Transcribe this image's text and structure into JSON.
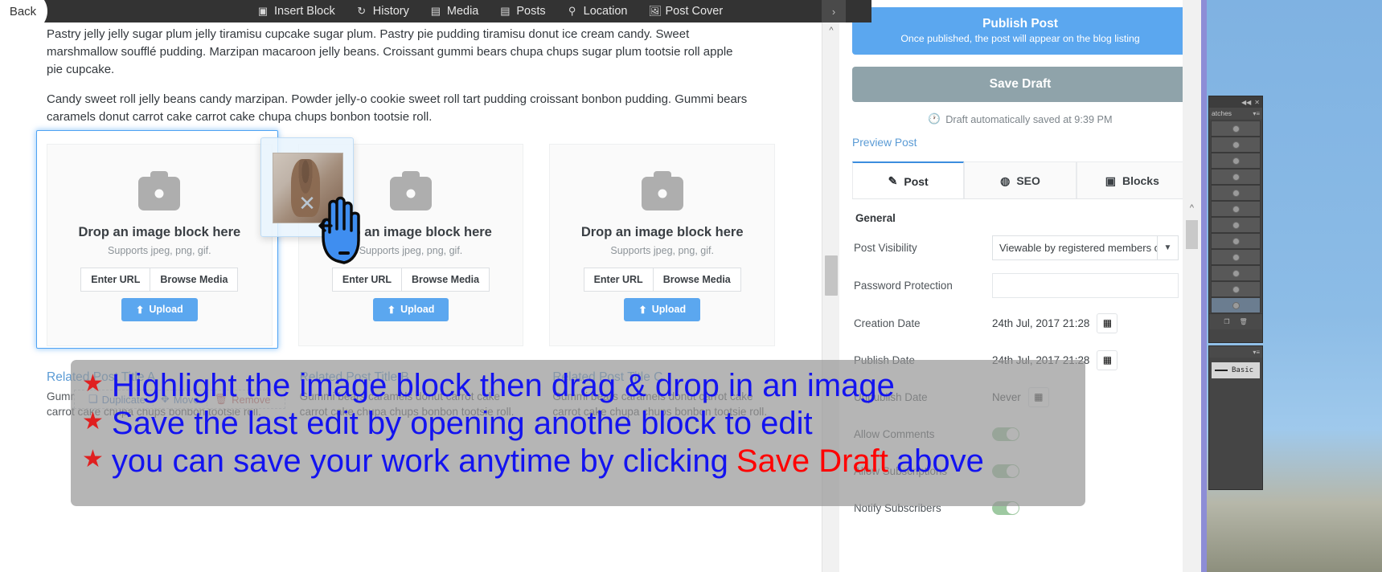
{
  "topbar": {
    "back_label": "Back",
    "menu": [
      {
        "label": "Insert Block",
        "icon": "cube-icon"
      },
      {
        "label": "History",
        "icon": "history-icon"
      },
      {
        "label": "Media",
        "icon": "camera-icon"
      },
      {
        "label": "Posts",
        "icon": "document-icon"
      },
      {
        "label": "Location",
        "icon": "map-pin-icon"
      },
      {
        "label": "Post Cover",
        "icon": "image-icon"
      }
    ],
    "overflow_chevron": "›"
  },
  "editor": {
    "paragraphs": [
      "Pastry jelly jelly sugar plum jelly tiramisu cupcake sugar plum. Pastry pie pudding tiramisu donut ice cream candy. Sweet marshmallow soufflé pudding. Marzipan macaroon jelly beans. Croissant gummi bears chupa chups sugar plum tootsie roll apple pie cupcake.",
      "Candy sweet roll jelly beans candy marzipan. Powder jelly-o cookie sweet roll tart pudding croissant bonbon pudding. Gummi bears caramels donut carrot cake carrot cake chupa chups bonbon tootsie roll."
    ],
    "image_blocks": [
      {
        "title": "Drop an image block here",
        "subtitle": "Supports jpeg, png, gif.",
        "enter_url": "Enter URL",
        "browse": "Browse Media",
        "upload": "Upload"
      },
      {
        "title": "Drop an image block here",
        "subtitle": "Supports jpeg, png, gif.",
        "enter_url": "Enter URL",
        "browse": "Browse Media",
        "upload": "Upload"
      },
      {
        "title": "Drop an image block here",
        "subtitle": "Supports jpeg, png, gif.",
        "enter_url": "Enter URL",
        "browse": "Browse Media",
        "upload": "Upload"
      }
    ],
    "block_toolbar": {
      "duplicate": "Duplicate",
      "move": "Move",
      "remove": "Remove"
    },
    "related_posts": [
      {
        "title": "Related Post Title A",
        "body": "Gummi bears caramels donut carrot cake carrot cake chupa chups bonbon tootsie roll."
      },
      {
        "title": "Related Post Title B",
        "body": "Gummi bears caramels donut carrot cake carrot cake chupa chups bonbon tootsie roll."
      },
      {
        "title": "Related Post Title C",
        "body": "Gummi bears caramels donut carrot cake carrot cake chupa chups bonbon tootsie roll."
      }
    ]
  },
  "sidebar": {
    "publish": {
      "title": "Publish Post",
      "subtitle": "Once published, the post will appear on the blog listing"
    },
    "save_draft": "Save Draft",
    "autosave": "Draft automatically saved at 9:39 PM",
    "autosave_icon": "clock-icon",
    "preview_link": "Preview Post",
    "tabs": [
      {
        "label": "Post",
        "icon": "pencil-icon",
        "active": true
      },
      {
        "label": "SEO",
        "icon": "globe-icon",
        "active": false
      },
      {
        "label": "Blocks",
        "icon": "cube-icon",
        "active": false
      }
    ],
    "general": {
      "heading": "General",
      "post_visibility_label": "Post Visibility",
      "post_visibility_value": "Viewable by registered members o",
      "password_label": "Password Protection",
      "password_value": "",
      "creation_date_label": "Creation Date",
      "creation_date_value": "24th Jul, 2017 21:28",
      "publish_date_label": "Publish Date",
      "publish_date_value": "24th Jul, 2017 21:28",
      "unpublish_date_label": "Unpublish Date",
      "unpublish_date_value": "Never",
      "allow_comments_label": "Allow Comments",
      "allow_subscriptions_label": "Allow Subscriptions",
      "notify_subscribers_label": "Notify Subscribers"
    }
  },
  "photoshop": {
    "swatches_tab": "atches",
    "basic_label": "Basic",
    "collapse_icon": "collapse-icon",
    "close_icon": "close-icon",
    "menu_icon": "panel-menu-icon",
    "new_swatch_icon": "new-swatch-icon",
    "trash_icon": "trash-icon"
  },
  "annotation": {
    "lines": [
      {
        "star": "★",
        "parts": [
          {
            "text": "Highlight the image block then  drag & drop in an image",
            "color": "blue"
          }
        ]
      },
      {
        "star": "★",
        "parts": [
          {
            "text": "Save the last edit by  opening anothe block  to edit",
            "color": "blue"
          }
        ]
      },
      {
        "star": "★",
        "parts": [
          {
            "text": "you can save your work anytime by clicking ",
            "color": "blue"
          },
          {
            "text": "Save Draft",
            "color": "red"
          },
          {
            "text": " above",
            "color": "blue"
          }
        ]
      }
    ]
  },
  "colors": {
    "accent_blue": "#5ba7ef",
    "save_draft_gray": "#8fa3aa",
    "topbar_dark": "#333333",
    "annotation_blue": "#1313f0",
    "annotation_red": "#ff0000"
  }
}
